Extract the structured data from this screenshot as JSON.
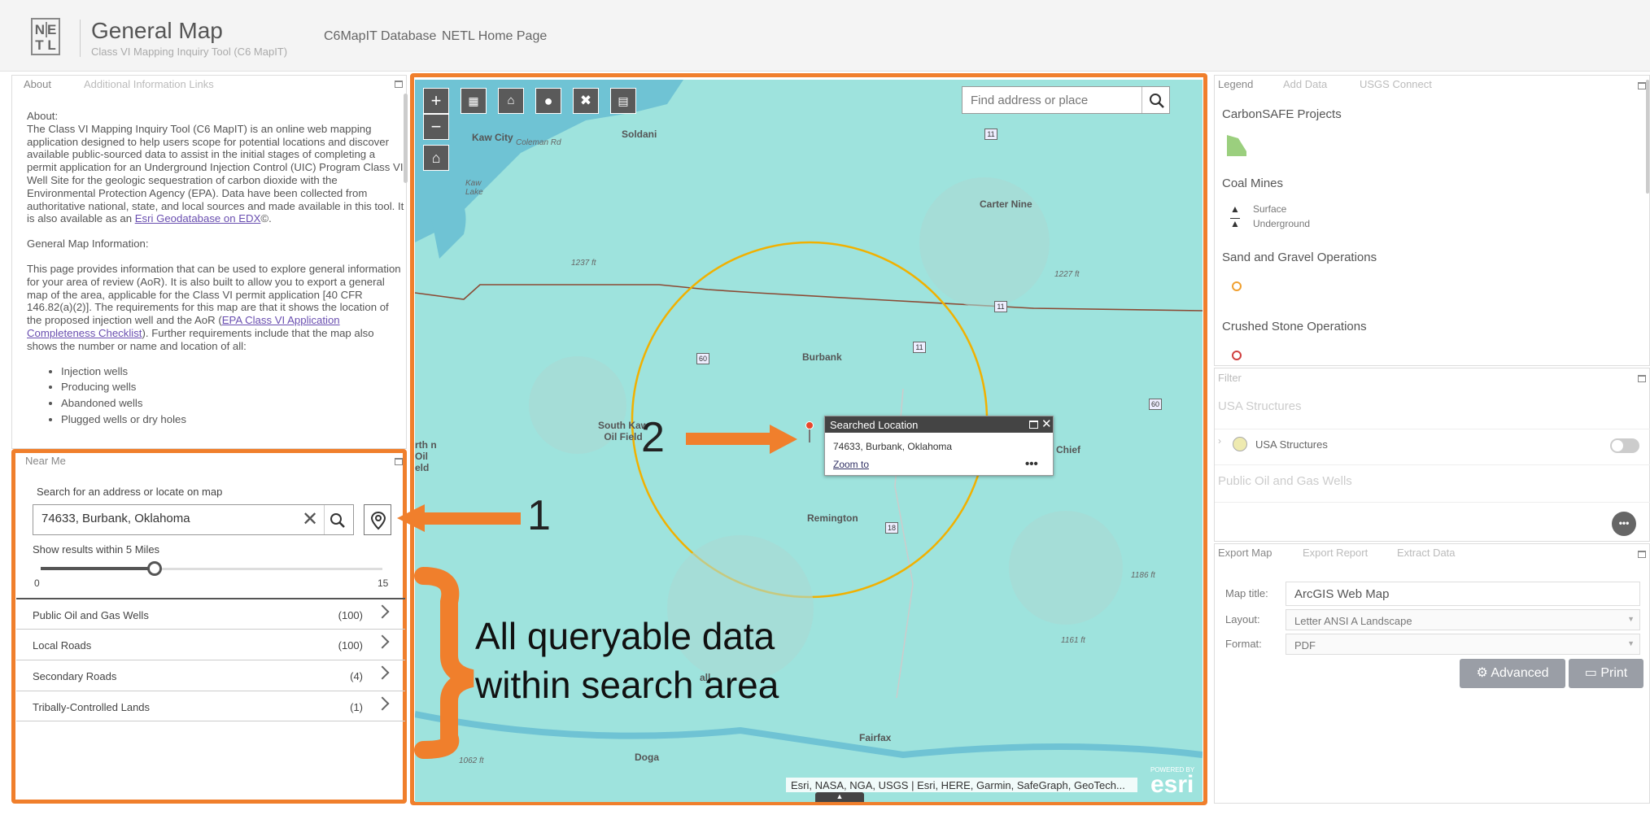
{
  "header": {
    "logo_text": "NETL",
    "title": "General Map",
    "subtitle": "Class VI Mapping Inquiry Tool (C6 MapIT)",
    "links": [
      "C6MapIT Database",
      "NETL Home Page"
    ]
  },
  "about_panel": {
    "tabs": [
      "About",
      "Additional Information Links"
    ],
    "heading": "About:",
    "para1": "The Class VI Mapping Inquiry Tool (C6 MapIT) is an online web mapping application designed to help users scope for potential locations and discover available public-sourced data to assist in the initial stages of completing a permit application for an Underground Injection Control (UIC) Program Class VI Well Site for the geologic sequestration of carbon dioxide with the Environmental Protection Agency (EPA). Data have been collected from authoritative national, state, and local sources and made available in this tool. It is also available as an ",
    "para1_link": "Esri Geodatabase on EDX",
    "para1_end": "©.",
    "heading2": "General Map Information:",
    "para2": "This page provides information that can be used to explore general information for your area of review (AoR). It is also built to allow you to export a general map of the area, applicable for the Class VI permit application [40 CFR 146.82(a)(2)]. The requirements for this map are that it shows the location of the proposed injection well and the AoR (",
    "para2_link": "EPA Class VI Application Completeness Checklist",
    "para2_end": "). Further requirements include that the map also shows the number or name and location of all:",
    "bullets": [
      "Injection wells",
      "Producing wells",
      "Abandoned wells",
      "Plugged wells or dry holes"
    ]
  },
  "near_me": {
    "title": "Near Me",
    "search_label": "Search for an address or locate on map",
    "search_value": "74633, Burbank, Oklahoma",
    "radius_label": "Show results within 5 Miles",
    "slider": {
      "min": "0",
      "max": "15",
      "value": 5
    },
    "results": [
      {
        "label": "Public Oil and Gas Wells",
        "count": "(100)"
      },
      {
        "label": "Local Roads",
        "count": "(100)"
      },
      {
        "label": "Secondary Roads",
        "count": "(4)"
      },
      {
        "label": "Tribally-Controlled Lands",
        "count": "(1)"
      }
    ]
  },
  "map": {
    "search_placeholder": "Find address or place",
    "labels": {
      "kaw_city": "Kaw City",
      "soldani": "Soldani",
      "coleman": "Coleman Rd",
      "kaw_lake": "Kaw Lake",
      "carter_nine": "Carter Nine",
      "burbank": "Burbank",
      "south_kaw": "South Kaw Oil Field",
      "remington": "Remington",
      "fairfax": "Fairfax",
      "doga": "Doga",
      "chief": "e Chief",
      "north_oil": "rth n Oil eld",
      "gall": "all"
    },
    "elevations": [
      "1237 ft",
      "1227 ft",
      "1186 ft",
      "1161 ft",
      "1062 ft"
    ],
    "shields": [
      "11",
      "60",
      "11",
      "11",
      "18",
      "60"
    ],
    "popup": {
      "title": "Searched Location",
      "address": "74633, Burbank, Oklahoma",
      "zoom": "Zoom to"
    },
    "attribution": "Esri, NASA, NGA, USGS | Esri, HERE, Garmin, SafeGraph, GeoTech...",
    "esri_small": "POWERED BY",
    "esri_big": "esri"
  },
  "legend_panel": {
    "tabs": [
      "Legend",
      "Add Data",
      "USGS Connect"
    ],
    "carbonsafe": "CarbonSAFE Projects",
    "coal_mines": "Coal Mines",
    "surface": "Surface",
    "underground": "Underground",
    "sand": "Sand and Gravel Operations",
    "crushed": "Crushed Stone Operations"
  },
  "filter_panel": {
    "title": "Filter",
    "group1": "USA Structures",
    "item1": "USA Structures",
    "group2": "Public Oil and Gas Wells"
  },
  "export_panel": {
    "tabs": [
      "Export Map",
      "Export Report",
      "Extract Data"
    ],
    "map_title_label": "Map title:",
    "map_title_value": "ArcGIS Web Map",
    "layout_label": "Layout:",
    "layout_value": "Letter ANSI A Landscape",
    "format_label": "Format:",
    "format_value": "PDF",
    "advanced": "Advanced",
    "print": "Print"
  },
  "annotations": {
    "one": "1",
    "two": "2",
    "text": "All queryable data within search area"
  },
  "colors": {
    "annotation": "#f07f2c",
    "map_water": "#9ee3dd",
    "circle": "#f1b100",
    "road": "#8b4a34"
  }
}
